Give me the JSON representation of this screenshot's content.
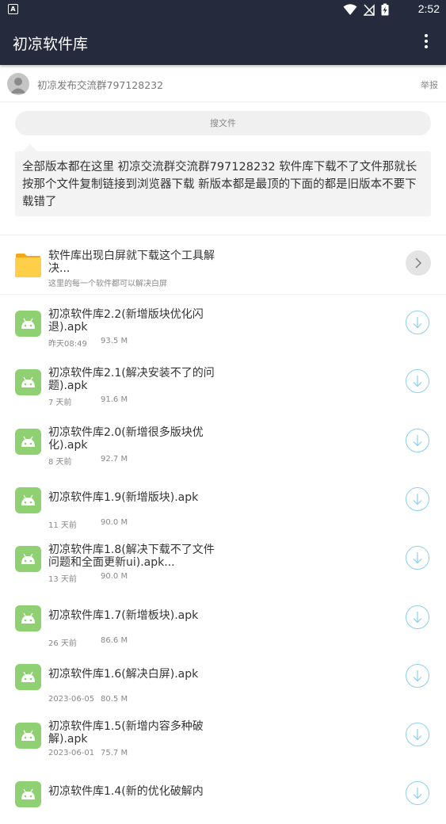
{
  "status_bar": {
    "time": "2:52"
  },
  "app_bar": {
    "title": "初凉软件库"
  },
  "owner": {
    "name": "初凉发布交流群797128232",
    "report_label": "举报"
  },
  "search": {
    "label": "搜文件"
  },
  "notice": {
    "text": "全部版本都在这里 初凉交流群交流群797128232 软件库下载不了文件那就长按那个文件复制链接到浏览器下载 新版本都是最顶的下面的都是旧版本不要下载错了"
  },
  "folder": {
    "name_line1": "软件库出现白屏就下载这个工具解",
    "name_line2": "决...",
    "desc": "这里的每一个软件都可以解决白屏"
  },
  "files": [
    {
      "line1": "初凉软件库2.2(新增版块优化闪",
      "line2": "退).apk",
      "time": "昨天08:49",
      "size": "93.5 M"
    },
    {
      "line1": "初凉软件库2.1(解决安装不了的问",
      "line2": "题).apk",
      "time": "7 天前",
      "size": "91.6 M"
    },
    {
      "line1": "初凉软件库2.0(新增很多版块优",
      "line2": "化).apk",
      "time": "8 天前",
      "size": "92.7 M"
    },
    {
      "line1": "初凉软件库1.9(新增版块).apk",
      "line2": "",
      "time": "11 天前",
      "size": "90.0 M"
    },
    {
      "line1": "初凉软件库1.8(解决下载不了文件",
      "line2": "问题和全面更新ui).apk...",
      "time": "13 天前",
      "size": "90.0 M"
    },
    {
      "line1": "初凉软件库1.7(新增板块).apk",
      "line2": "",
      "time": "26 天前",
      "size": "86.6 M"
    },
    {
      "line1": "初凉软件库1.6(解决白屏).apk",
      "line2": "",
      "time": "2023-06-05",
      "size": "80.5 M"
    },
    {
      "line1": "初凉软件库1.5(新增内容多种破",
      "line2": "解).apk",
      "time": "2023-06-01",
      "size": "75.7 M"
    },
    {
      "line1": "初凉软件库1.4(新的优化破解内",
      "line2": "",
      "time": "",
      "size": ""
    }
  ],
  "colors": {
    "app_bar": "#262a3d",
    "apk_icon": "#8fd172",
    "folder_icon": "#ffc83d",
    "download_ring": "#8ad0ee"
  }
}
